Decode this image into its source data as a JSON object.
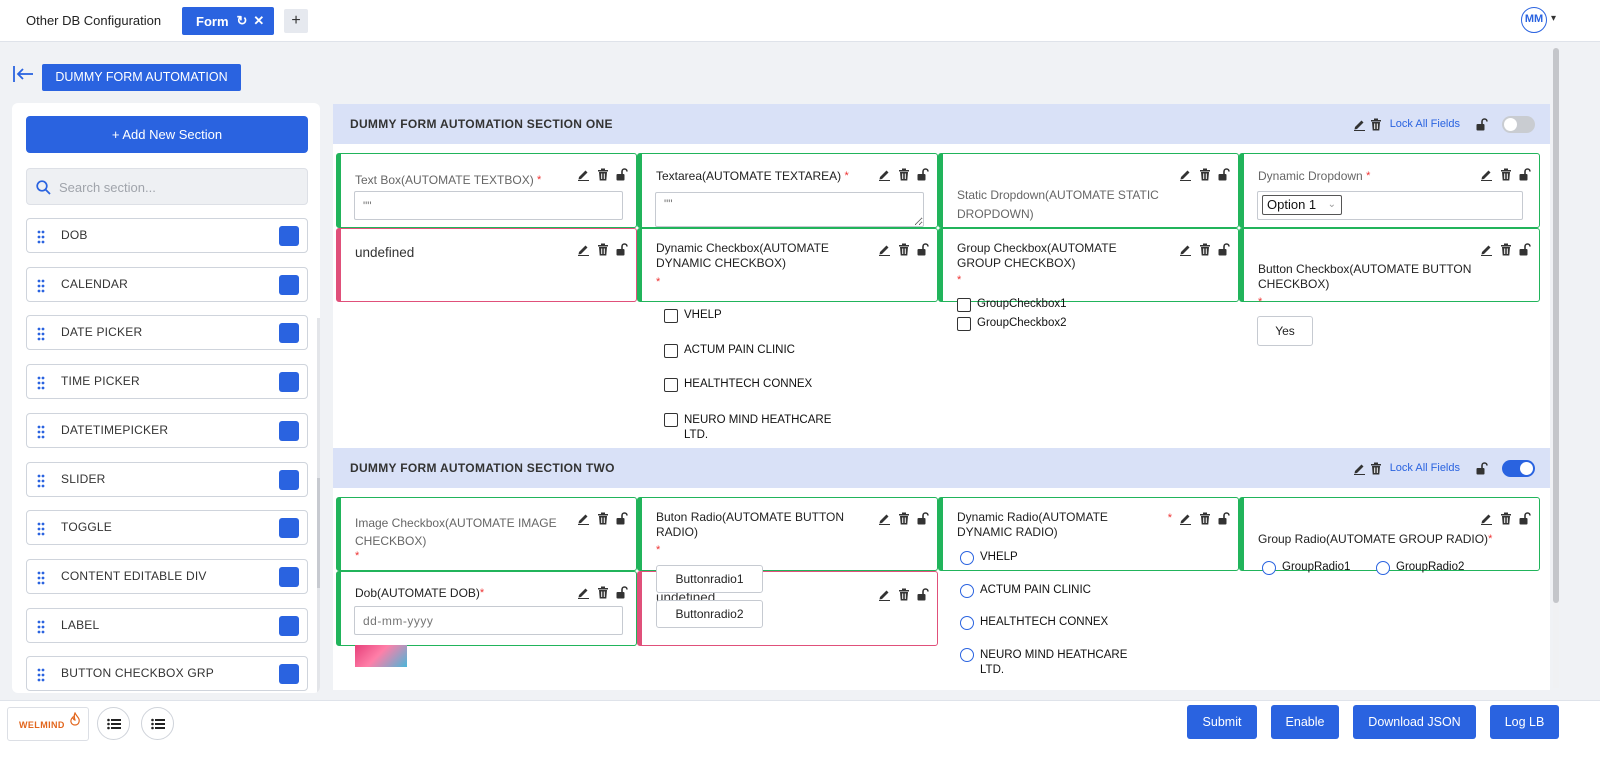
{
  "tabs": {
    "other": "Other DB Configuration",
    "active": "Form",
    "add": "+"
  },
  "user": {
    "initials": "MM"
  },
  "form_title": "DUMMY FORM AUTOMATION",
  "sidebar": {
    "add_section": "+ Add New Section",
    "search_placeholder": "Search section...",
    "items": [
      "DOB",
      "CALENDAR",
      "DATE PICKER",
      "TIME PICKER",
      "DATETIMEPICKER",
      "SLIDER",
      "TOGGLE",
      "CONTENT EDITABLE DIV",
      "LABEL",
      "BUTTON CHECKBOX GRP"
    ]
  },
  "sections": [
    {
      "title": "DUMMY FORM AUTOMATION SECTION ONE",
      "lock_all": "Lock All Fields",
      "toggle_on": false
    },
    {
      "title": "DUMMY FORM AUTOMATION SECTION TWO",
      "lock_all": "Lock All Fields",
      "toggle_on": true
    }
  ],
  "fields": {
    "textbox": {
      "label": "Text Box(AUTOMATE TEXTBOX)",
      "placeholder": "\"\""
    },
    "textarea": {
      "label": "Textarea(AUTOMATE TEXTAREA)",
      "placeholder": "\"\""
    },
    "static_dd": {
      "label": "Static Dropdown(AUTOMATE STATIC DROPDOWN)"
    },
    "dynamic_dd": {
      "label": "Dynamic Dropdown",
      "value": "Option 1"
    },
    "undef1": {
      "label": "undefined"
    },
    "dyn_checkbox": {
      "label": "Dynamic Checkbox(AUTOMATE DYNAMIC CHECKBOX)",
      "options": [
        "VHELP",
        "ACTUM PAIN CLINIC",
        "HEALTHTECH CONNEX",
        "NEURO MIND HEATHCARE LTD."
      ]
    },
    "group_checkbox": {
      "label": "Group Checkbox(AUTOMATE GROUP CHECKBOX)",
      "options": [
        "GroupCheckbox1",
        "GroupCheckbox2"
      ]
    },
    "button_checkbox": {
      "label": "Button Checkbox(AUTOMATE BUTTON CHECKBOX)",
      "option": "Yes"
    },
    "image_checkbox": {
      "label": "Image Checkbox(AUTOMATE IMAGE CHECKBOX)"
    },
    "button_radio": {
      "label": "Buton Radio(AUTOMATE BUTTON RADIO)",
      "options": [
        "Buttonradio1",
        "Buttonradio2"
      ]
    },
    "dynamic_radio": {
      "label": "Dynamic Radio(AUTOMATE DYNAMIC RADIO)",
      "options": [
        "VHELP",
        "ACTUM PAIN CLINIC",
        "HEALTHTECH CONNEX",
        "NEURO MIND HEATHCARE LTD."
      ]
    },
    "group_radio": {
      "label": "Group Radio(AUTOMATE GROUP RADIO)",
      "options": [
        "GroupRadio1",
        "GroupRadio2"
      ]
    },
    "dob": {
      "label": "Dob(AUTOMATE DOB)",
      "placeholder": "dd-mm-yyyy"
    },
    "undef2": {
      "label": "undefined"
    }
  },
  "required_mark": "*",
  "bottom": {
    "logo": "WELMIND",
    "buttons": [
      "Submit",
      "Enable",
      "Download JSON",
      "Log LB"
    ]
  },
  "colors": {
    "primary": "#2a63e0",
    "field_ok": "#21b45b",
    "field_err": "#e0507a",
    "section_bg": "#d9e1f7"
  }
}
